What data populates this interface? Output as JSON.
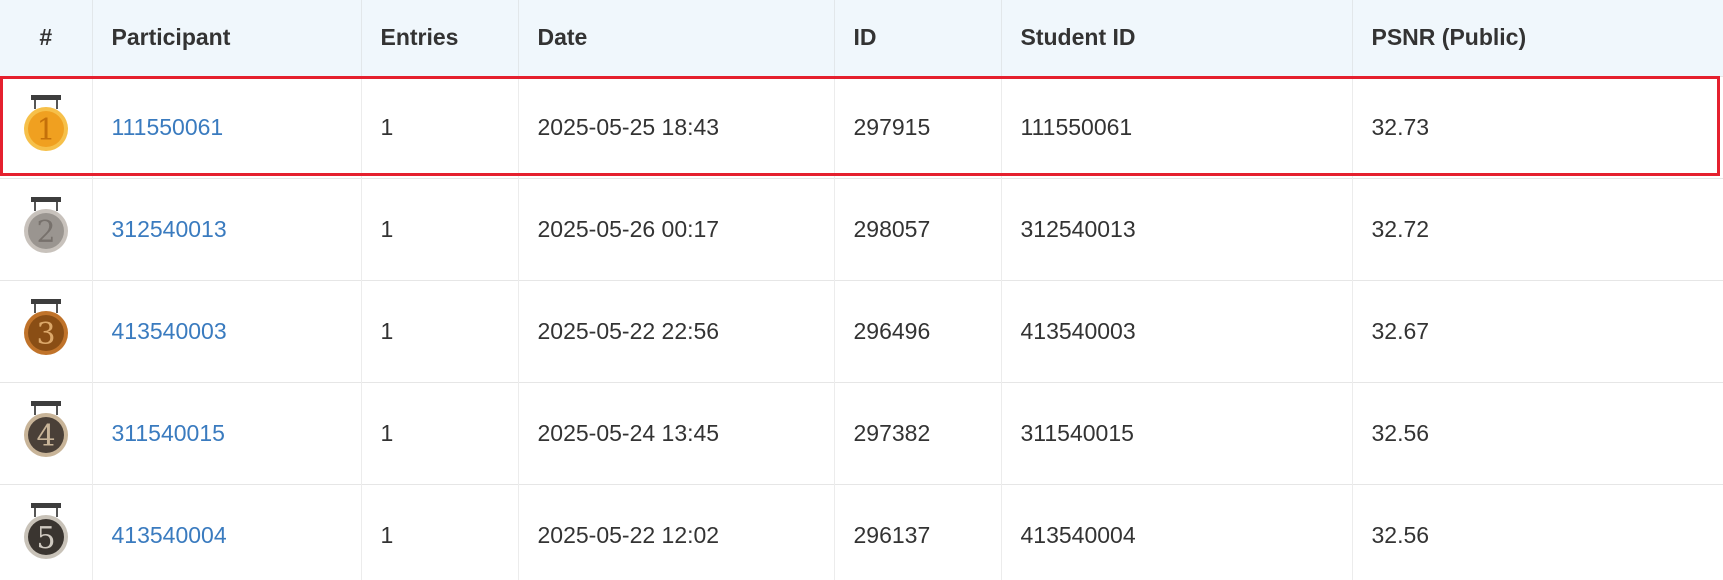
{
  "headers": {
    "rank": "#",
    "participant": "Participant",
    "entries": "Entries",
    "date": "Date",
    "id": "ID",
    "student_id": "Student ID",
    "psnr": "PSNR (Public)"
  },
  "rows": [
    {
      "rank": "1",
      "participant": "111550061",
      "entries": "1",
      "date": "2025-05-25 18:43",
      "id": "297915",
      "student_id": "111550061",
      "psnr": "32.73"
    },
    {
      "rank": "2",
      "participant": "312540013",
      "entries": "1",
      "date": "2025-05-26 00:17",
      "id": "298057",
      "student_id": "312540013",
      "psnr": "32.72"
    },
    {
      "rank": "3",
      "participant": "413540003",
      "entries": "1",
      "date": "2025-05-22 22:56",
      "id": "296496",
      "student_id": "413540003",
      "psnr": "32.67"
    },
    {
      "rank": "4",
      "participant": "311540015",
      "entries": "1",
      "date": "2025-05-24 13:45",
      "id": "297382",
      "student_id": "311540015",
      "psnr": "32.56"
    },
    {
      "rank": "5",
      "participant": "413540004",
      "entries": "1",
      "date": "2025-05-22 12:02",
      "id": "296137",
      "student_id": "413540004",
      "psnr": "32.56"
    }
  ],
  "medals": [
    {
      "icon": "gold-medal-icon",
      "fill": "#f0a020",
      "ring": "#f6c04a",
      "text": "#c4700a"
    },
    {
      "icon": "silver-medal-icon",
      "fill": "#9a9590",
      "ring": "#c8c2bc",
      "text": "#77716c"
    },
    {
      "icon": "bronze-medal-icon",
      "fill": "#8a4e15",
      "ring": "#c0732a",
      "text": "#dca86a"
    },
    {
      "icon": "medal-4-icon",
      "fill": "#4a4038",
      "ring": "#c8b498",
      "text": "#c8b498"
    },
    {
      "icon": "medal-5-icon",
      "fill": "#3a3530",
      "ring": "#c8c2b8",
      "text": "#cfc9c0"
    }
  ],
  "highlight_color": "#e5202e",
  "link_color": "#3a7bbf",
  "header_bg": "#f0f7fc"
}
